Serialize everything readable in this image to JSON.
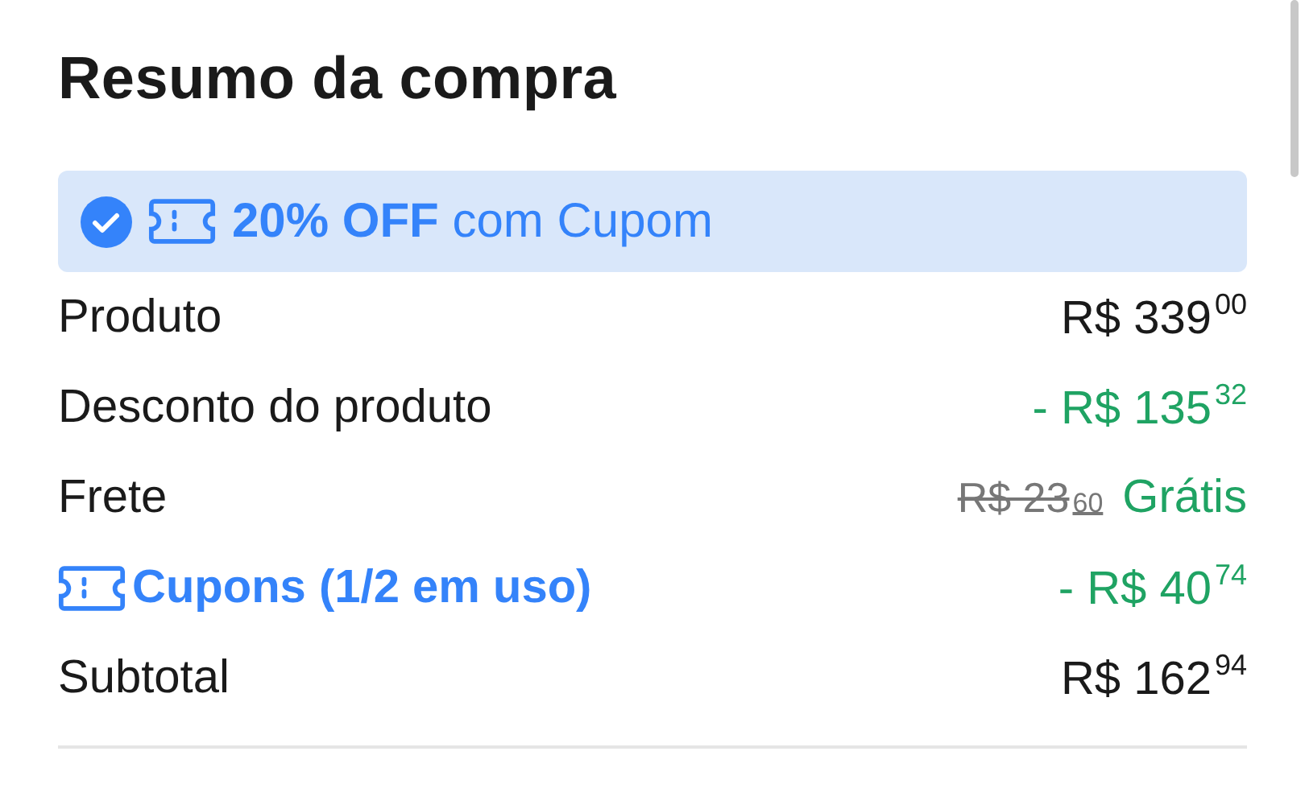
{
  "title": "Resumo da compra",
  "promo_banner": {
    "applied": true,
    "text": "**20% OFF** com Cupom"
  },
  "rows": [
    {
      "kind": "plain",
      "label": "Produto",
      "amount": {
        "currency": "R$",
        "whole": "339",
        "cents": "00",
        "kind": "regular"
      }
    },
    {
      "kind": "plain",
      "label": "Desconto do produto",
      "amount": {
        "sign": "-",
        "currency": "R$",
        "whole": "135",
        "cents": "32",
        "kind": "discount"
      }
    },
    {
      "kind": "plain",
      "label": "Frete",
      "original_amount": {
        "currency": "R$",
        "whole": "23",
        "cents": "60"
      },
      "free_label": "Grátis"
    },
    {
      "kind": "link",
      "label": "Cupons (1/2 em uso)",
      "amount": {
        "sign": "-",
        "currency": "R$",
        "whole": "40",
        "cents": "74",
        "kind": "discount"
      }
    },
    {
      "kind": "plain",
      "label": "Subtotal",
      "amount": {
        "currency": "R$",
        "whole": "162",
        "cents": "94",
        "kind": "regular"
      }
    }
  ]
}
